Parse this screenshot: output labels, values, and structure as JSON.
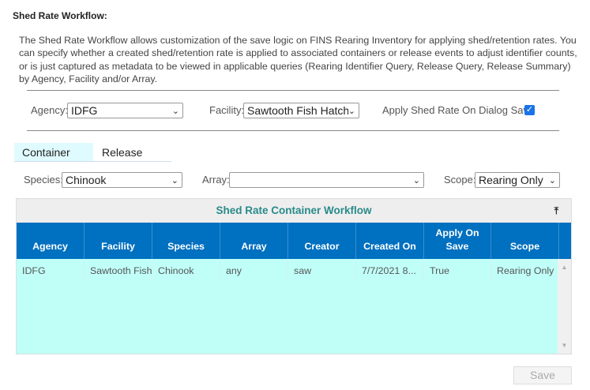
{
  "title": "Shed Rate Workflow:",
  "description": "The Shed Rate Workflow allows customization of the save logic on FINS Rearing Inventory for applying shed/retention rates. You can specify whether a created shed/retention rate is applied to associated containers or release events to adjust identifier counts, or is just captured as metadata to be viewed in applicable queries (Rearing Identifier Query, Release Query, Release Summary) by Agency, Facility and/or Array.",
  "filters": {
    "agency_label": "Agency:",
    "agency_value": "IDFG",
    "facility_label": "Facility:",
    "facility_value": "Sawtooth Fish Hatche",
    "apply_label": "Apply Shed Rate On Dialog Save",
    "apply_checked": true
  },
  "tabs": [
    {
      "label": "Container",
      "active": true
    },
    {
      "label": "Release",
      "active": false
    }
  ],
  "subfilters": {
    "species_label": "Species:",
    "species_value": "Chinook",
    "array_label": "Array:",
    "array_value": "",
    "scope_label": "Scope:",
    "scope_value": "Rearing Only"
  },
  "grid": {
    "title": "Shed Rate Container Workflow",
    "export_icon": "export-icon",
    "columns": [
      "Agency",
      "Facility",
      "Species",
      "Array",
      "Creator",
      "Created On",
      "Apply On Save",
      "Scope"
    ],
    "rows": [
      [
        "IDFG",
        "Sawtooth Fish",
        "Chinook",
        "any",
        "saw",
        "7/7/2021 8...",
        "True",
        "Rearing Only"
      ]
    ]
  },
  "save_label": "Save",
  "colors": {
    "header": "#0070c0",
    "grid_bg": "#c0fff8",
    "grid_title": "#2a8a8a"
  }
}
